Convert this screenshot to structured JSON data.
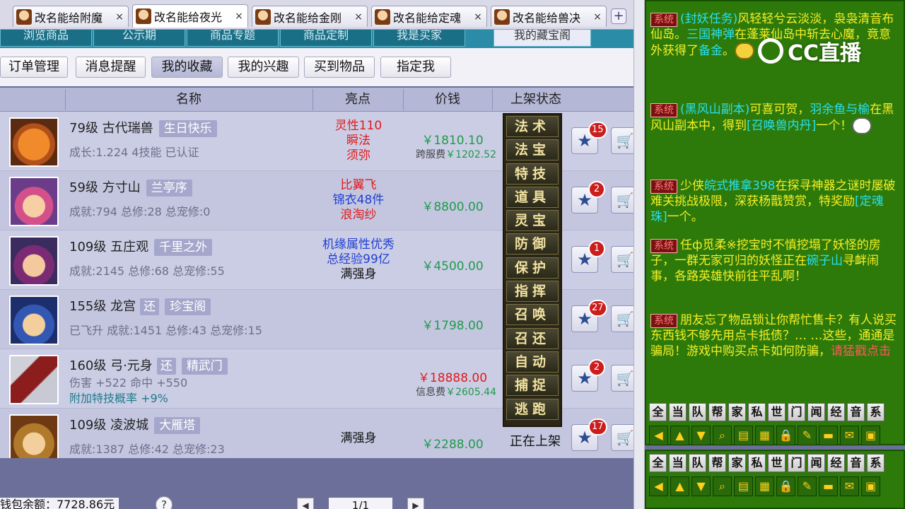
{
  "tabs": [
    {
      "label": "改名能给附魔",
      "active": false
    },
    {
      "label": "改名能给夜光",
      "active": true
    },
    {
      "label": "改名能给金刚",
      "active": false
    },
    {
      "label": "改名能给定魂",
      "active": false
    },
    {
      "label": "改名能给兽决",
      "active": false
    }
  ],
  "tab_add": "+",
  "tab_close": "×",
  "categories": [
    {
      "label": "浏览商品",
      "selected": false
    },
    {
      "label": "公示期",
      "selected": false
    },
    {
      "label": "商品专题",
      "selected": false
    },
    {
      "label": "商品定制",
      "selected": false
    },
    {
      "label": "我是买家",
      "selected": false
    },
    {
      "label": "我的藏宝阁",
      "selected": true
    }
  ],
  "subnav": [
    {
      "label": "订单管理",
      "selected": false
    },
    {
      "label": "消息提醒",
      "selected": false
    },
    {
      "label": "我的收藏",
      "selected": true
    },
    {
      "label": "我的兴趣",
      "selected": false
    },
    {
      "label": "买到物品",
      "selected": false
    },
    {
      "label": "指定我",
      "selected": false
    }
  ],
  "columns": {
    "name": "名称",
    "highlight": "亮点",
    "price": "价钱",
    "status": "上架状态"
  },
  "rows": [
    {
      "title": "79级  古代瑞兽",
      "tags": [
        "生日快乐"
      ],
      "line1": "成长:1.224  4技能  已认证",
      "line2": "",
      "highlights": [
        {
          "text": "灵性110",
          "color": "#e01a1a"
        },
        {
          "text": "瞬法",
          "color": "#e01a1a"
        },
        {
          "text": "须弥",
          "color": "#e01a1a"
        }
      ],
      "price": "￥1810.10",
      "price_color": "#1f9a4a",
      "fee_label": "跨服费",
      "fee": "￥1202.52",
      "status": "",
      "favorites": "15"
    },
    {
      "title": "59级  方寸山",
      "tags": [
        "兰亭序"
      ],
      "line1": "成就:794  总修:28  总宠修:0",
      "line2": "",
      "highlights": [
        {
          "text": "比翼飞",
          "color": "#e01a1a"
        },
        {
          "text": "锦衣48件",
          "color": "#1f3fd1"
        },
        {
          "text": "浪淘纱",
          "color": "#e01a1a"
        }
      ],
      "price": "￥8800.00",
      "price_color": "#1f9a4a",
      "fee_label": "",
      "fee": "",
      "status": "",
      "favorites": "2"
    },
    {
      "title": "109级  五庄观",
      "tags": [
        "千里之外"
      ],
      "line1": "成就:2145  总修:68  总宠修:55",
      "line2": "",
      "highlights": [
        {
          "text": "机缘属性优秀",
          "color": "#1f3fd1"
        },
        {
          "text": "总经验99亿",
          "color": "#1f3fd1"
        },
        {
          "text": "满强身",
          "color": "#111111"
        }
      ],
      "price": "￥4500.00",
      "price_color": "#1f9a4a",
      "fee_label": "",
      "fee": "",
      "status": "",
      "favorites": "1"
    },
    {
      "title": "155级  龙宫",
      "tags": [
        "还",
        "珍宝阁"
      ],
      "line1": "已飞升  成就:1451  总修:43  总宠修:15",
      "line2": "",
      "highlights": [],
      "price": "￥1798.00",
      "price_color": "#1f9a4a",
      "fee_label": "",
      "fee": "",
      "status": "",
      "favorites": "27"
    },
    {
      "title": "160级  弓·元身",
      "tags": [
        "还",
        "精武门"
      ],
      "line1": "伤害 +522  命中 +550",
      "line2": "附加特技概率 +9%",
      "highlights": [],
      "price": "￥18888.00",
      "price_color": "#e01a1a",
      "fee_label": "信息费",
      "fee": "￥2605.44",
      "status": "",
      "favorites": "2"
    },
    {
      "title": "109级  凌波城",
      "tags": [
        "大雁塔"
      ],
      "line1": "成就:1387  总修:42  总宠修:23",
      "line2": "",
      "highlights": [
        {
          "text": "满强身",
          "color": "#111111"
        }
      ],
      "price": "￥2288.00",
      "price_color": "#1f9a4a",
      "fee_label": "",
      "fee": "",
      "status": "正在上架",
      "favorites": "17"
    }
  ],
  "battle_menu": [
    "法术",
    "法宝",
    "特技",
    "道具",
    "灵宝",
    "防御",
    "保护",
    "指挥",
    "召唤",
    "召还",
    "自动",
    "捕捉",
    "逃跑"
  ],
  "footer": {
    "balance": "钱包余额：7728.86元",
    "help": "?",
    "page": "1/1",
    "prev": "◀",
    "next": "▶"
  },
  "brand": "CC直播",
  "chat": {
    "sys_label": "系统",
    "messages": [
      {
        "parts": [
          {
            "t": "(封妖任务)",
            "c": "cy"
          },
          {
            "t": "风轻轻兮云淡淡，袅袅清音布仙岛。",
            "c": ""
          },
          {
            "t": "三国神弹",
            "c": "cy"
          },
          {
            "t": "在蓬莱仙岛中斩去心魔，竟意外获得了",
            "c": ""
          },
          {
            "t": "备金",
            "c": "cy"
          },
          {
            "t": "。",
            "c": ""
          }
        ],
        "emoji": "y"
      },
      {
        "parts": [
          {
            "t": "(黑风山副本)",
            "c": "cy"
          },
          {
            "t": "可喜可贺，",
            "c": ""
          },
          {
            "t": "羽余鱼与榆",
            "c": "cy"
          },
          {
            "t": "在黑风山副本中，得到",
            "c": ""
          },
          {
            "t": "[召唤兽内丹]",
            "c": "cy"
          },
          {
            "t": "一个！",
            "c": ""
          }
        ],
        "emoji": "w"
      },
      {
        "parts": [
          {
            "t": "少侠",
            "c": ""
          },
          {
            "t": "皖式推拿398",
            "c": "cy"
          },
          {
            "t": "在探寻神器之谜时屡破难关挑战极限，深获杨戬赞赏，特奖励",
            "c": ""
          },
          {
            "t": "[定魂珠]",
            "c": "cy"
          },
          {
            "t": "一个。",
            "c": ""
          }
        ],
        "emoji": ""
      },
      {
        "parts": [
          {
            "t": "任ф觅柔※",
            "c": ""
          },
          {
            "t": "挖宝时不慎挖塌了妖怪的房子，一群无家可归的妖怪正在",
            "c": ""
          },
          {
            "t": "碗子山",
            "c": "cy"
          },
          {
            "t": "寻衅闹事，各路英雄快前往平乱啊！",
            "c": ""
          }
        ],
        "emoji": ""
      },
      {
        "parts": [
          {
            "t": "朋友忘了物品锁让你帮忙售卡？有人说买东西钱不够先用点卡抵债？…   …这些，通通是骗局！游戏中购买点卡如何防骗，",
            "c": ""
          },
          {
            "t": "请猛戳点击",
            "c": "rd"
          }
        ],
        "emoji": ""
      }
    ],
    "channels": [
      "全",
      "当",
      "队",
      "帮",
      "家",
      "私",
      "世",
      "门",
      "闻",
      "经",
      "音",
      "系"
    ],
    "tools": [
      "◀",
      "▲",
      "▼",
      "⌕",
      "▤",
      "▦",
      "🔒",
      "✎",
      "▬",
      "✉",
      "▣"
    ]
  },
  "chat2": {
    "channels": [
      "全",
      "当",
      "队",
      "帮",
      "家",
      "私",
      "世",
      "门",
      "闻",
      "经",
      "音",
      "系"
    ]
  }
}
